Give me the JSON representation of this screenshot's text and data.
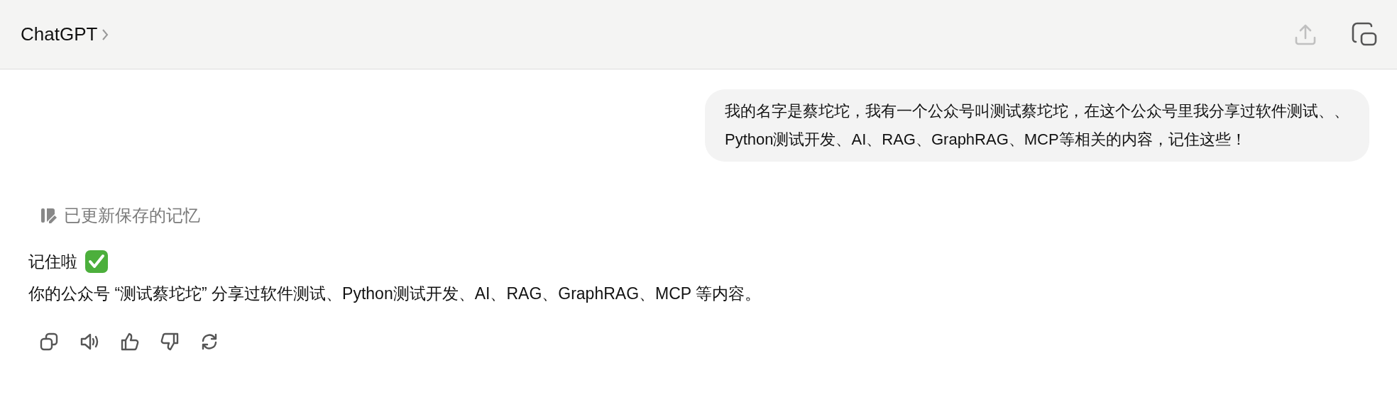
{
  "header": {
    "title": "ChatGPT"
  },
  "user_message": {
    "lines": [
      "我的名字是蔡坨坨，我有一个公众号叫测试蔡坨坨，在这个公众号里我分享过软件测试、、",
      "Python测试开发、AI、RAG、GraphRAG、MCP等相关的内容，记住这些！"
    ]
  },
  "memory_notice": "已更新保存的记忆",
  "reply": {
    "lines": [
      "记住啦",
      "你的公众号 “测试蔡坨坨” 分享过软件测试、Python测试开发、AI、RAG、GraphRAG、MCP 等内容。"
    ]
  }
}
